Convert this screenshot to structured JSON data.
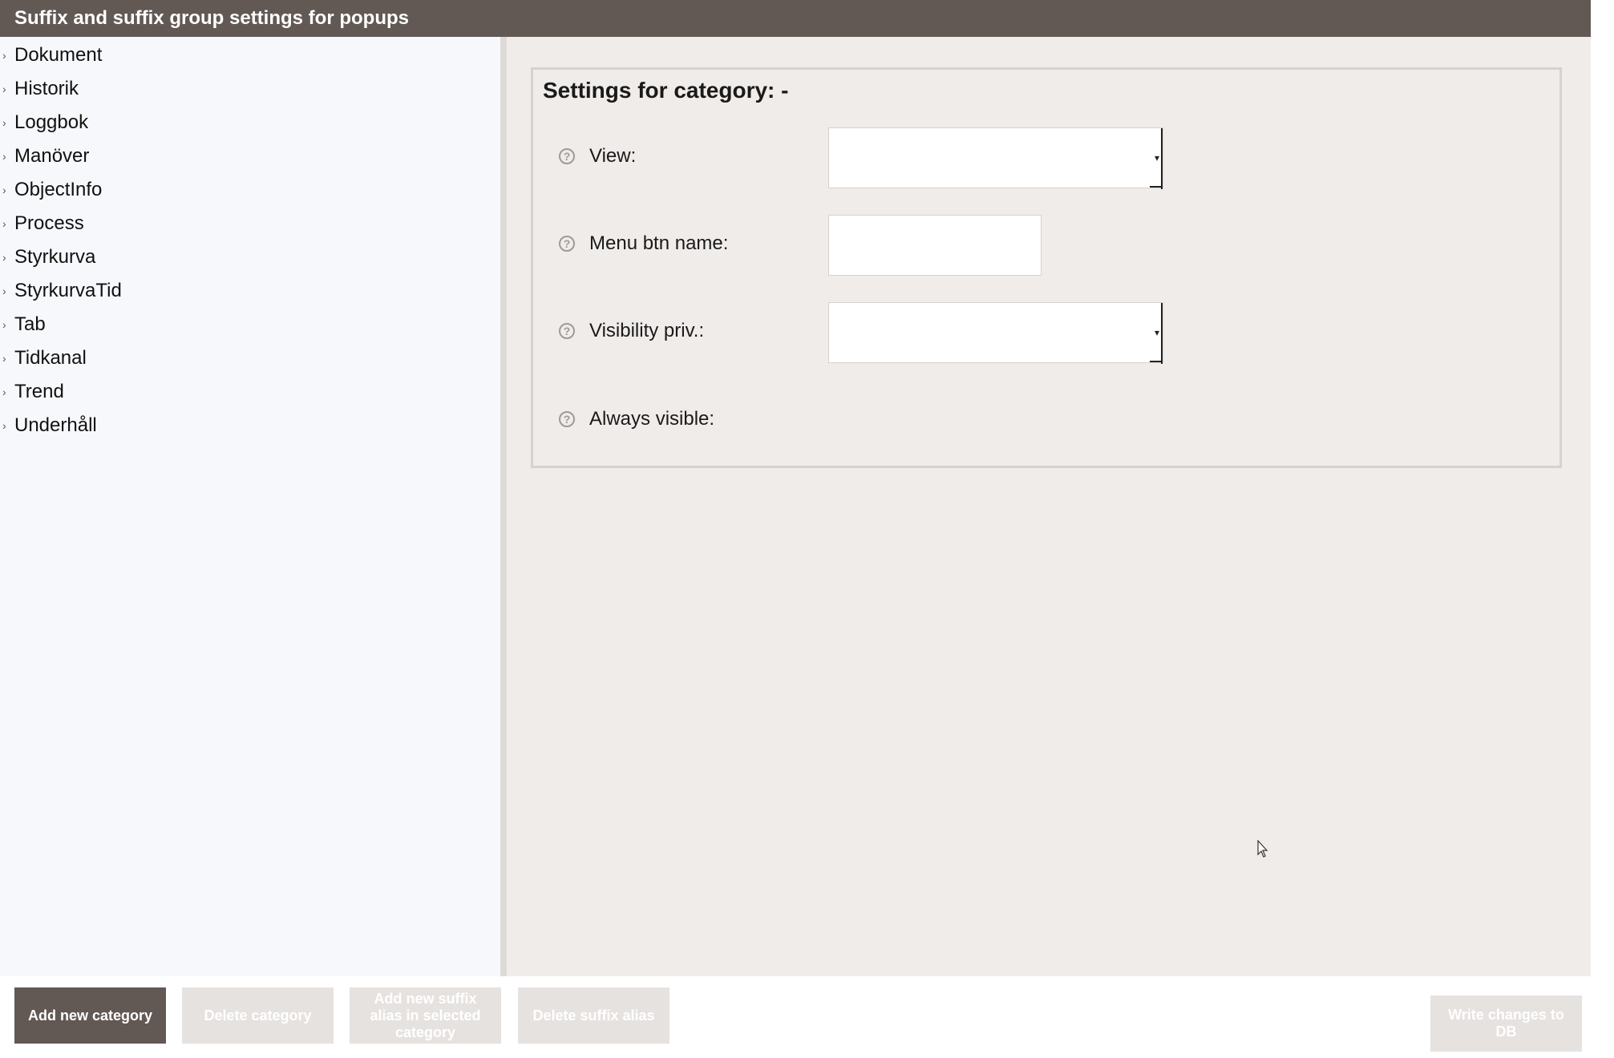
{
  "window": {
    "title": "Suffix and suffix group settings for popups"
  },
  "tree": {
    "items": [
      {
        "label": "Dokument"
      },
      {
        "label": "Historik"
      },
      {
        "label": "Loggbok"
      },
      {
        "label": "Manöver"
      },
      {
        "label": "ObjectInfo"
      },
      {
        "label": "Process"
      },
      {
        "label": "Styrkurva"
      },
      {
        "label": "StyrkurvaTid"
      },
      {
        "label": "Tab"
      },
      {
        "label": "Tidkanal"
      },
      {
        "label": "Trend"
      },
      {
        "label": "Underhåll"
      }
    ]
  },
  "settings": {
    "title": "Settings for category: -",
    "fields": {
      "view": {
        "label": "View:",
        "value": ""
      },
      "menu_btn_name": {
        "label": "Menu btn name:",
        "value": ""
      },
      "visibility_priv": {
        "label": "Visibility priv.:",
        "value": ""
      },
      "always_visible": {
        "label": "Always visible:"
      }
    },
    "help_glyph": "?"
  },
  "footer": {
    "add_category": "Add new category",
    "delete_category": "Delete category",
    "add_suffix_alias": "Add new suffix alias in selected category",
    "delete_suffix_alias": "Delete suffix alias",
    "write_changes": "Write changes to DB"
  },
  "colors": {
    "titlebar": "#625854",
    "primary_button": "#625854",
    "disabled_button": "#e6e2e0",
    "main_bg": "#f0ecea",
    "tree_bg": "#f7f8fc"
  }
}
